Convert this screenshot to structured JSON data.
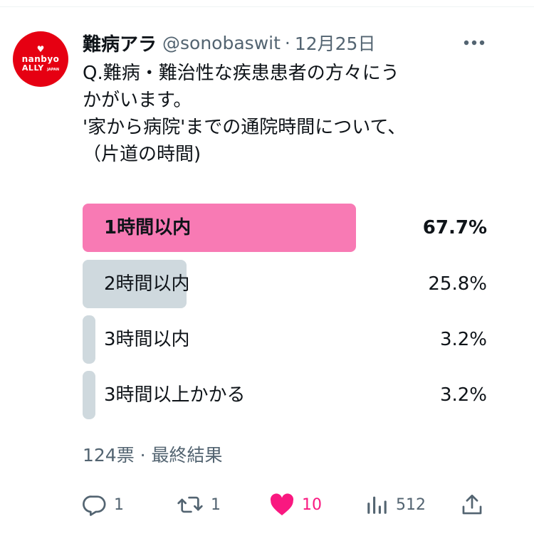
{
  "account": {
    "avatar_text_top": "nanbyo",
    "avatar_text_bottom": "ALLY",
    "avatar_text_small": "JAPAN",
    "display_name": "難病アラ",
    "handle": "@sonobaswit",
    "separator": "·",
    "date": "12月25日"
  },
  "tweet": {
    "text": "Q.難病・難治性な疾患患者の方々にう\nかがいます。\n'家から病院'までの通院時間について、\n（片道の時間)"
  },
  "poll": {
    "options": [
      {
        "label": "1時間以内",
        "percent_text": "67.7%",
        "fraction": 0.677,
        "winner": true
      },
      {
        "label": "2時間以内",
        "percent_text": "25.8%",
        "fraction": 0.258,
        "winner": false
      },
      {
        "label": "3時間以内",
        "percent_text": "3.2%",
        "fraction": 0.032,
        "winner": false
      },
      {
        "label": "3時間以上かかる",
        "percent_text": "3.2%",
        "fraction": 0.032,
        "winner": false
      }
    ],
    "meta": "124票 · 最終結果",
    "winner_color": "#f87ab4",
    "other_color": "#cfd9de"
  },
  "actions": {
    "reply_count": "1",
    "retweet_count": "1",
    "like_count": "10",
    "view_count": "512"
  },
  "colors": {
    "like": "#f91880",
    "secondary_text": "#536471",
    "brand_red": "#e60012"
  }
}
